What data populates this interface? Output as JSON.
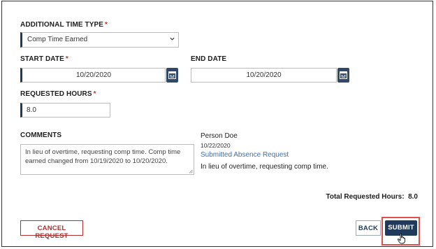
{
  "form": {
    "additional_time_type": {
      "label": "ADDITIONAL TIME TYPE",
      "required_mark": "*",
      "value": "Comp Time Earned"
    },
    "start_date": {
      "label": "START DATE",
      "required_mark": "*",
      "value": "10/20/2020"
    },
    "end_date": {
      "label": "END DATE",
      "value": "10/20/2020"
    },
    "requested_hours": {
      "label": "REQUESTED HOURS",
      "required_mark": "*",
      "value": "8.0"
    },
    "comments": {
      "label": "COMMENTS",
      "value": "In lieu of overtime, requesting comp time. Comp time earned changed from 10/19/2020 to 10/20/2020."
    }
  },
  "history": {
    "author": "Person Doe",
    "date": "10/22/2020",
    "action": "Submitted Absence Request",
    "note": "In lieu of overtime, requesting comp time."
  },
  "total": {
    "label": "Total Requested Hours:",
    "value": "8.0"
  },
  "buttons": {
    "cancel": "CANCEL REQUEST",
    "back": "BACK",
    "submit": "SUBMIT"
  },
  "icons": {
    "calendar": "calendar-icon",
    "chevron": "chevron-down-icon",
    "cursor": "hand-pointer-icon"
  }
}
